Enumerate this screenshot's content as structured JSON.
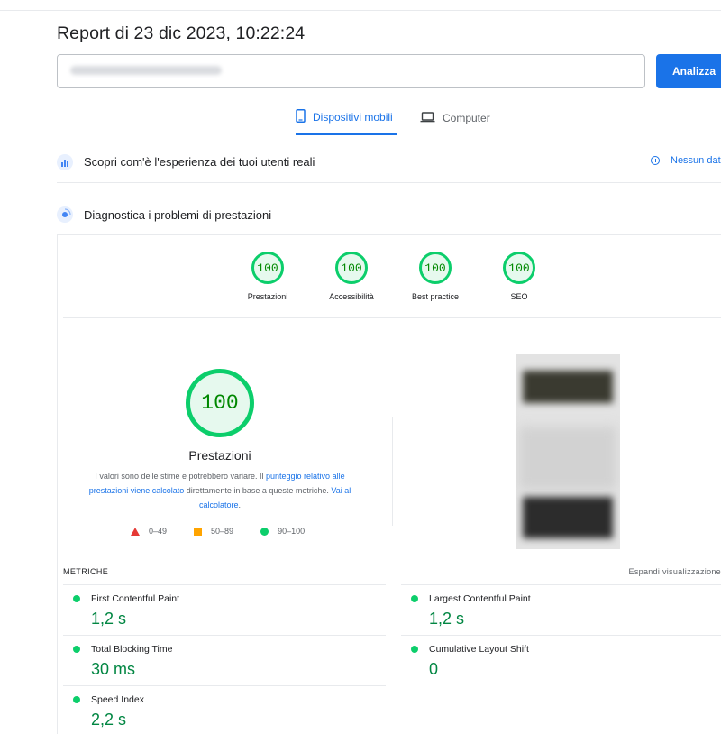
{
  "header": {
    "report_title": "Report di 23 dic 2023, 10:22:24"
  },
  "search": {
    "url_value": "",
    "analyze_label": "Analizza"
  },
  "tabs": [
    {
      "label": "Dispositivi mobili",
      "icon": "smartphone-icon",
      "active": true
    },
    {
      "label": "Computer",
      "icon": "laptop-icon",
      "active": false
    }
  ],
  "sections": {
    "crux": {
      "label": "Scopri com'è l'esperienza dei tuoi utenti reali",
      "icon": "users-chart-icon",
      "no_data_label": "Nessun dat"
    },
    "diagnostics": {
      "label": "Diagnostica i problemi di prestazioni",
      "icon": "lighthouse-icon"
    }
  },
  "categories": [
    {
      "label": "Prestazioni",
      "score": "100"
    },
    {
      "label": "Accessibilità",
      "score": "100"
    },
    {
      "label": "Best practice",
      "score": "100"
    },
    {
      "label": "SEO",
      "score": "100"
    }
  ],
  "performance": {
    "score": "100",
    "label": "Prestazioni",
    "desc_part1": "I valori sono delle stime e potrebbero variare. Il ",
    "desc_link1": "punteggio relativo alle prestazioni viene calcolato",
    "desc_part2": " direttamente in base a queste metriche. ",
    "desc_link2": "Vai al calcolatore",
    "desc_end": "."
  },
  "legend": [
    {
      "range": "0–49",
      "shape": "triangle",
      "color": "#e53935"
    },
    {
      "range": "50–89",
      "shape": "square",
      "color": "#ffa400"
    },
    {
      "range": "90–100",
      "shape": "circle",
      "color": "#0cce6b"
    }
  ],
  "metrics": {
    "heading": "METRICHE",
    "expand_label": "Espandi visualizzazione",
    "items": [
      {
        "name": "First Contentful Paint",
        "value": "1,2 s"
      },
      {
        "name": "Largest Contentful Paint",
        "value": "1,2 s"
      },
      {
        "name": "Total Blocking Time",
        "value": "30 ms"
      },
      {
        "name": "Cumulative Layout Shift",
        "value": "0"
      },
      {
        "name": "Speed Index",
        "value": "2,2 s"
      }
    ]
  },
  "colors": {
    "accent": "#1a73e8",
    "pass": "#0cce6b",
    "pass_text": "#018642"
  }
}
